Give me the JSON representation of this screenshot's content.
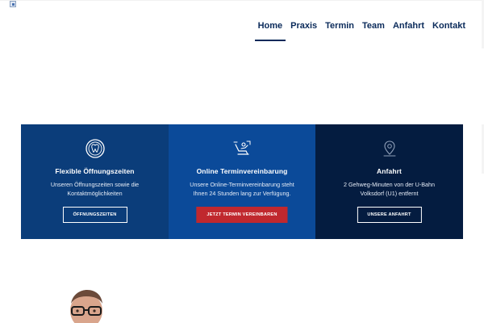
{
  "header": {
    "nav": [
      {
        "label": "Home",
        "active": true
      },
      {
        "label": "Praxis",
        "active": false
      },
      {
        "label": "Termin",
        "active": false
      },
      {
        "label": "Team",
        "active": false
      },
      {
        "label": "Anfahrt",
        "active": false
      },
      {
        "label": "Kontakt",
        "active": false
      }
    ]
  },
  "cards": [
    {
      "icon": "clock-tooth-icon",
      "title": "Flexible Öffnungszeiten",
      "desc_line1": "Unseren Öffnungszeiten sowie die",
      "desc_line2": "Kontaktmöglichkeiten",
      "button": "ÖFFNUNGSZEITEN",
      "bg": "#0b3d7a"
    },
    {
      "icon": "dental-chair-icon",
      "title": "Online Terminvereinbarung",
      "desc_line1": "Unsere Online-Terminvereinbarung steht",
      "desc_line2": "Ihnen 24 Stunden lang zur Verfügung.",
      "button": "JETZT TERMIN VEREINBAREN",
      "bg": "#0b4a99",
      "button_bg": "#c0282e"
    },
    {
      "icon": "map-pin-icon",
      "title": "Anfahrt",
      "desc_line1": "2 Gehweg-Minuten von der U-Bahn",
      "desc_line2": "Volksdorf (U1) entfernt",
      "button": "UNSERE ANFAHRT",
      "bg": "#041c40"
    }
  ],
  "colors": {
    "nav_text": "#0a2a5a",
    "accent_red": "#c0282e"
  }
}
